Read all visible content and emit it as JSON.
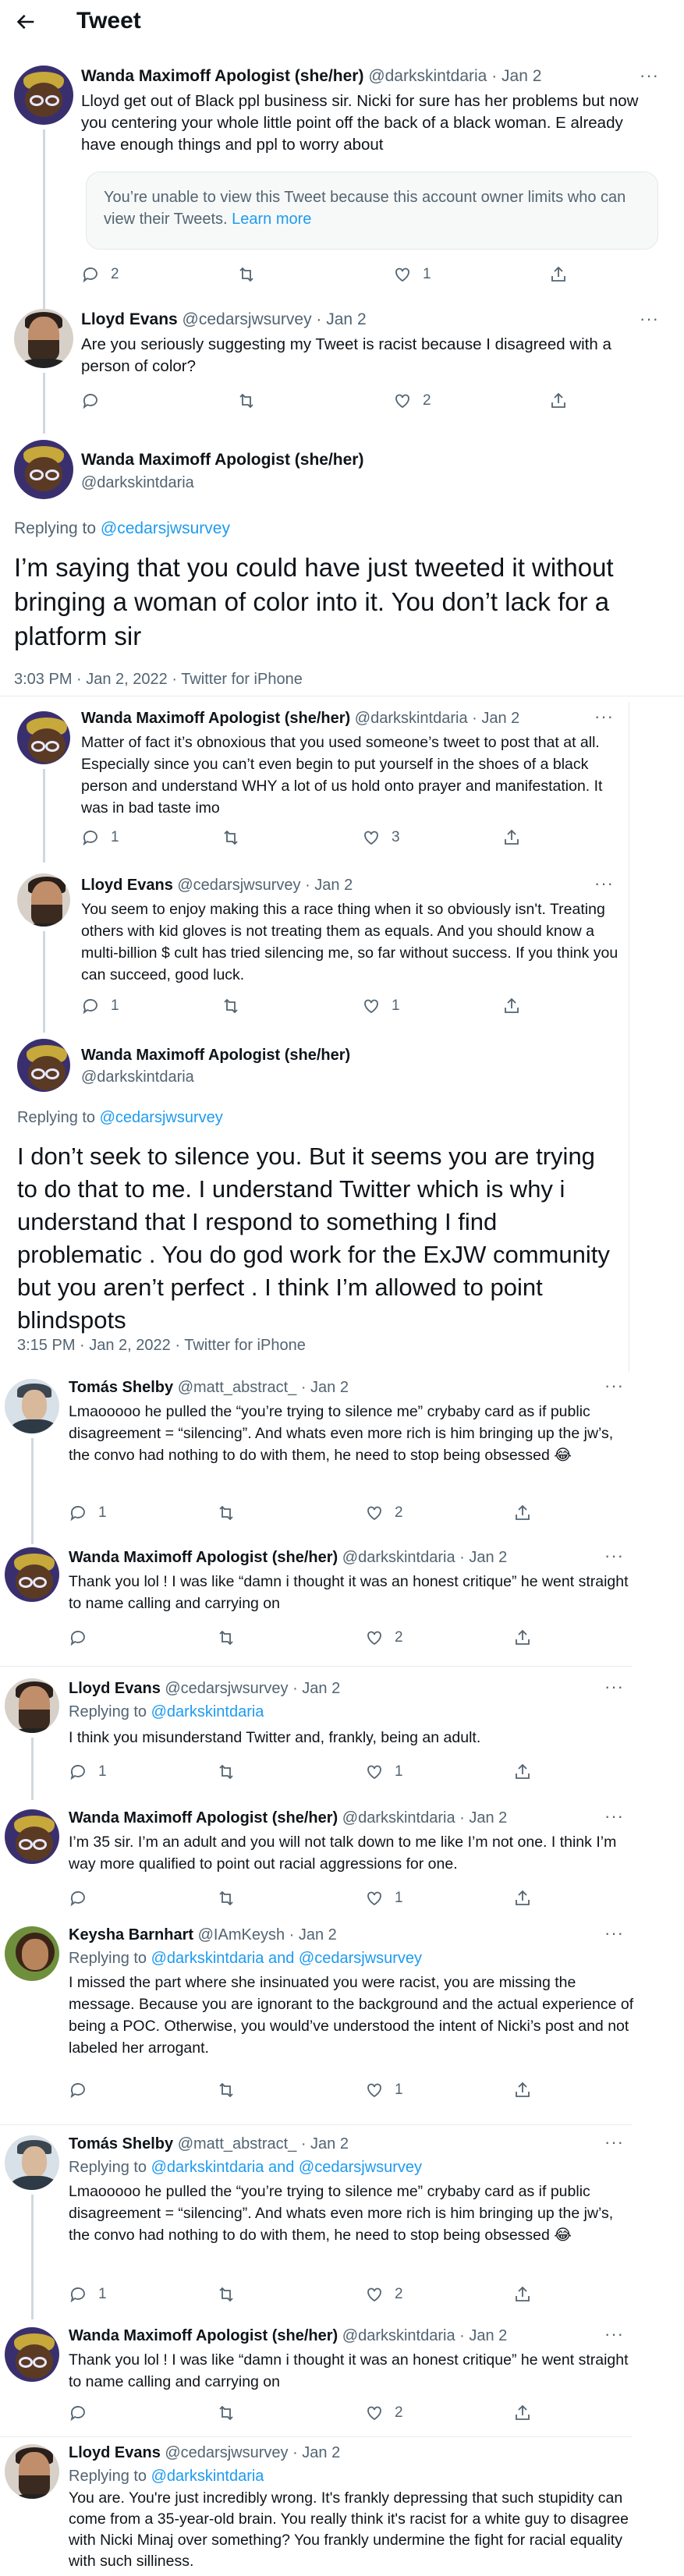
{
  "header": {
    "title": "Tweet"
  },
  "tweets": [
    {
      "name": "Wanda Maximoff Apologist (she/her)",
      "handle": "@darkskintdaria",
      "date": "· Jan 2",
      "text": "Lloyd get out of Black ppl business sir. Nicki for sure has her problems but now you centering your whole little point off the back of a black woman. E already have enough things and ppl to worry about",
      "notice": "You’re unable to view this Tweet because this account owner limits who can view their Tweets.",
      "notice_link": "Learn more",
      "replies": "2",
      "retweets": "",
      "likes": "1"
    },
    {
      "name": "Lloyd Evans",
      "handle": "@cedarsjwsurvey",
      "date": "· Jan 2",
      "text": "Are you seriously suggesting my Tweet is racist because I disagreed with a person of color?",
      "replies": "",
      "retweets": "",
      "likes": "2"
    }
  ],
  "main1": {
    "name": "Wanda Maximoff Apologist (she/her)",
    "handle": "@darkskintdaria",
    "replying_label": "Replying to",
    "replying_to": "@cedarsjwsurvey",
    "text": "I’m saying that you could have just tweeted it without bringing a woman of color into it. You don’t lack for a platform sir",
    "meta": "3:03 PM · Jan 2, 2022 · Twitter for iPhone"
  },
  "nested": [
    {
      "name": "Wanda Maximoff Apologist (she/her)",
      "handle": "@darkskintdaria",
      "date": "· Jan 2",
      "text": "Matter of fact it’s obnoxious that you used someone’s tweet to post that at all. Especially since you can’t even begin to put yourself in the shoes of a black person and understand WHY a lot of us hold onto prayer and manifestation. It was in bad taste imo",
      "replies": "1",
      "retweets": "",
      "likes": "3"
    },
    {
      "name": "Lloyd Evans",
      "handle": "@cedarsjwsurvey",
      "date": "· Jan 2",
      "text": "You seem to enjoy making this a race thing when it so obviously isn't. Treating others with kid gloves is not treating them as equals. And you should know a multi-billion $ cult has tried silencing me, so far without success. If you think you can succeed, good luck.",
      "replies": "1",
      "retweets": "",
      "likes": "1"
    }
  ],
  "main2": {
    "name": "Wanda Maximoff Apologist (she/her)",
    "handle": "@darkskintdaria",
    "replying_label": "Replying to",
    "replying_to": "@cedarsjwsurvey",
    "text": "I don’t seek to silence you. But it seems you are trying to do that to me. I understand Twitter which is why i understand that I respond to something I find problematic . You do god work for the ExJW community but you aren’t perfect . I think I’m allowed to point blindspots",
    "meta": "3:15 PM · Jan 2, 2022 · Twitter for iPhone"
  },
  "replies": [
    {
      "name": "Tomás Shelby",
      "handle": "@matt_abstract_",
      "date": "· Jan 2",
      "replying": "",
      "text": "Lmaooooo he pulled the “you’re trying to silence me” crybaby card as if public disagreement = “silencing”. And whats even more rich is him bringing up the jw’s, the convo had nothing to do with them, he need to stop being obsessed 😂",
      "replies": "1",
      "retweets": "",
      "likes": "2"
    },
    {
      "name": "Wanda Maximoff Apologist (she/her)",
      "handle": "@darkskintdaria",
      "date": "· Jan 2",
      "replying": "",
      "text": "Thank you lol ! I was like “damn i thought it was an honest critique” he went straight to name calling and carrying on",
      "replies": "",
      "retweets": "",
      "likes": "2"
    },
    {
      "name": "Lloyd Evans",
      "handle": "@cedarsjwsurvey",
      "date": "· Jan 2",
      "replying_label": "Replying to",
      "replying": "@darkskintdaria",
      "text": "I think you misunderstand Twitter and, frankly, being an adult.",
      "replies": "1",
      "retweets": "",
      "likes": "1"
    },
    {
      "name": "Wanda Maximoff Apologist (she/her)",
      "handle": "@darkskintdaria",
      "date": "· Jan 2",
      "replying": "",
      "text": "I’m 35 sir. I’m an adult and you will not talk down to me like I’m not one. I think I’m way more qualified to point out racial aggressions for one.",
      "replies": "",
      "retweets": "",
      "likes": "1"
    },
    {
      "name": "Keysha Barnhart",
      "handle": "@IAmKeysh",
      "date": "· Jan 2",
      "replying_label": "Replying to",
      "replying": "@darkskintdaria and @cedarsjwsurvey",
      "text": "I missed the part where she insinuated you were racist, you are missing the message. Because you are ignorant to the background and the actual experience of being a POC. Otherwise, you would’ve understood the intent of Nicki’s post and not labeled her arrogant.",
      "replies": "",
      "retweets": "",
      "likes": "1"
    },
    {
      "name": "Tomás Shelby",
      "handle": "@matt_abstract_",
      "date": "· Jan 2",
      "replying_label": "Replying to",
      "replying": "@darkskintdaria and @cedarsjwsurvey",
      "text": "Lmaooooo he pulled the “you’re trying to silence me” crybaby card as if public disagreement = “silencing”. And whats even more rich is him bringing up the jw’s, the convo had nothing to do with them, he need to stop being obsessed 😂",
      "replies": "1",
      "retweets": "",
      "likes": "2"
    },
    {
      "name": "Wanda Maximoff Apologist (she/her)",
      "handle": "@darkskintdaria",
      "date": "· Jan 2",
      "replying": "",
      "text": "Thank you lol ! I was like “damn i thought it was an honest critique” he went straight to name calling and carrying on",
      "replies": "",
      "retweets": "",
      "likes": "2"
    },
    {
      "name": "Lloyd Evans",
      "handle": "@cedarsjwsurvey",
      "date": "· Jan 2",
      "replying_label": "Replying to",
      "replying": "@darkskintdaria",
      "text": "You are. You're just incredibly wrong. It's frankly depressing that such stupidity can come from a 35-year-old brain. You really think it's racist for a white guy to disagree with Nicki Minaj over something? You frankly undermine the fight for racial equality with such silliness.",
      "replies": "",
      "retweets": "",
      "likes": ""
    }
  ]
}
